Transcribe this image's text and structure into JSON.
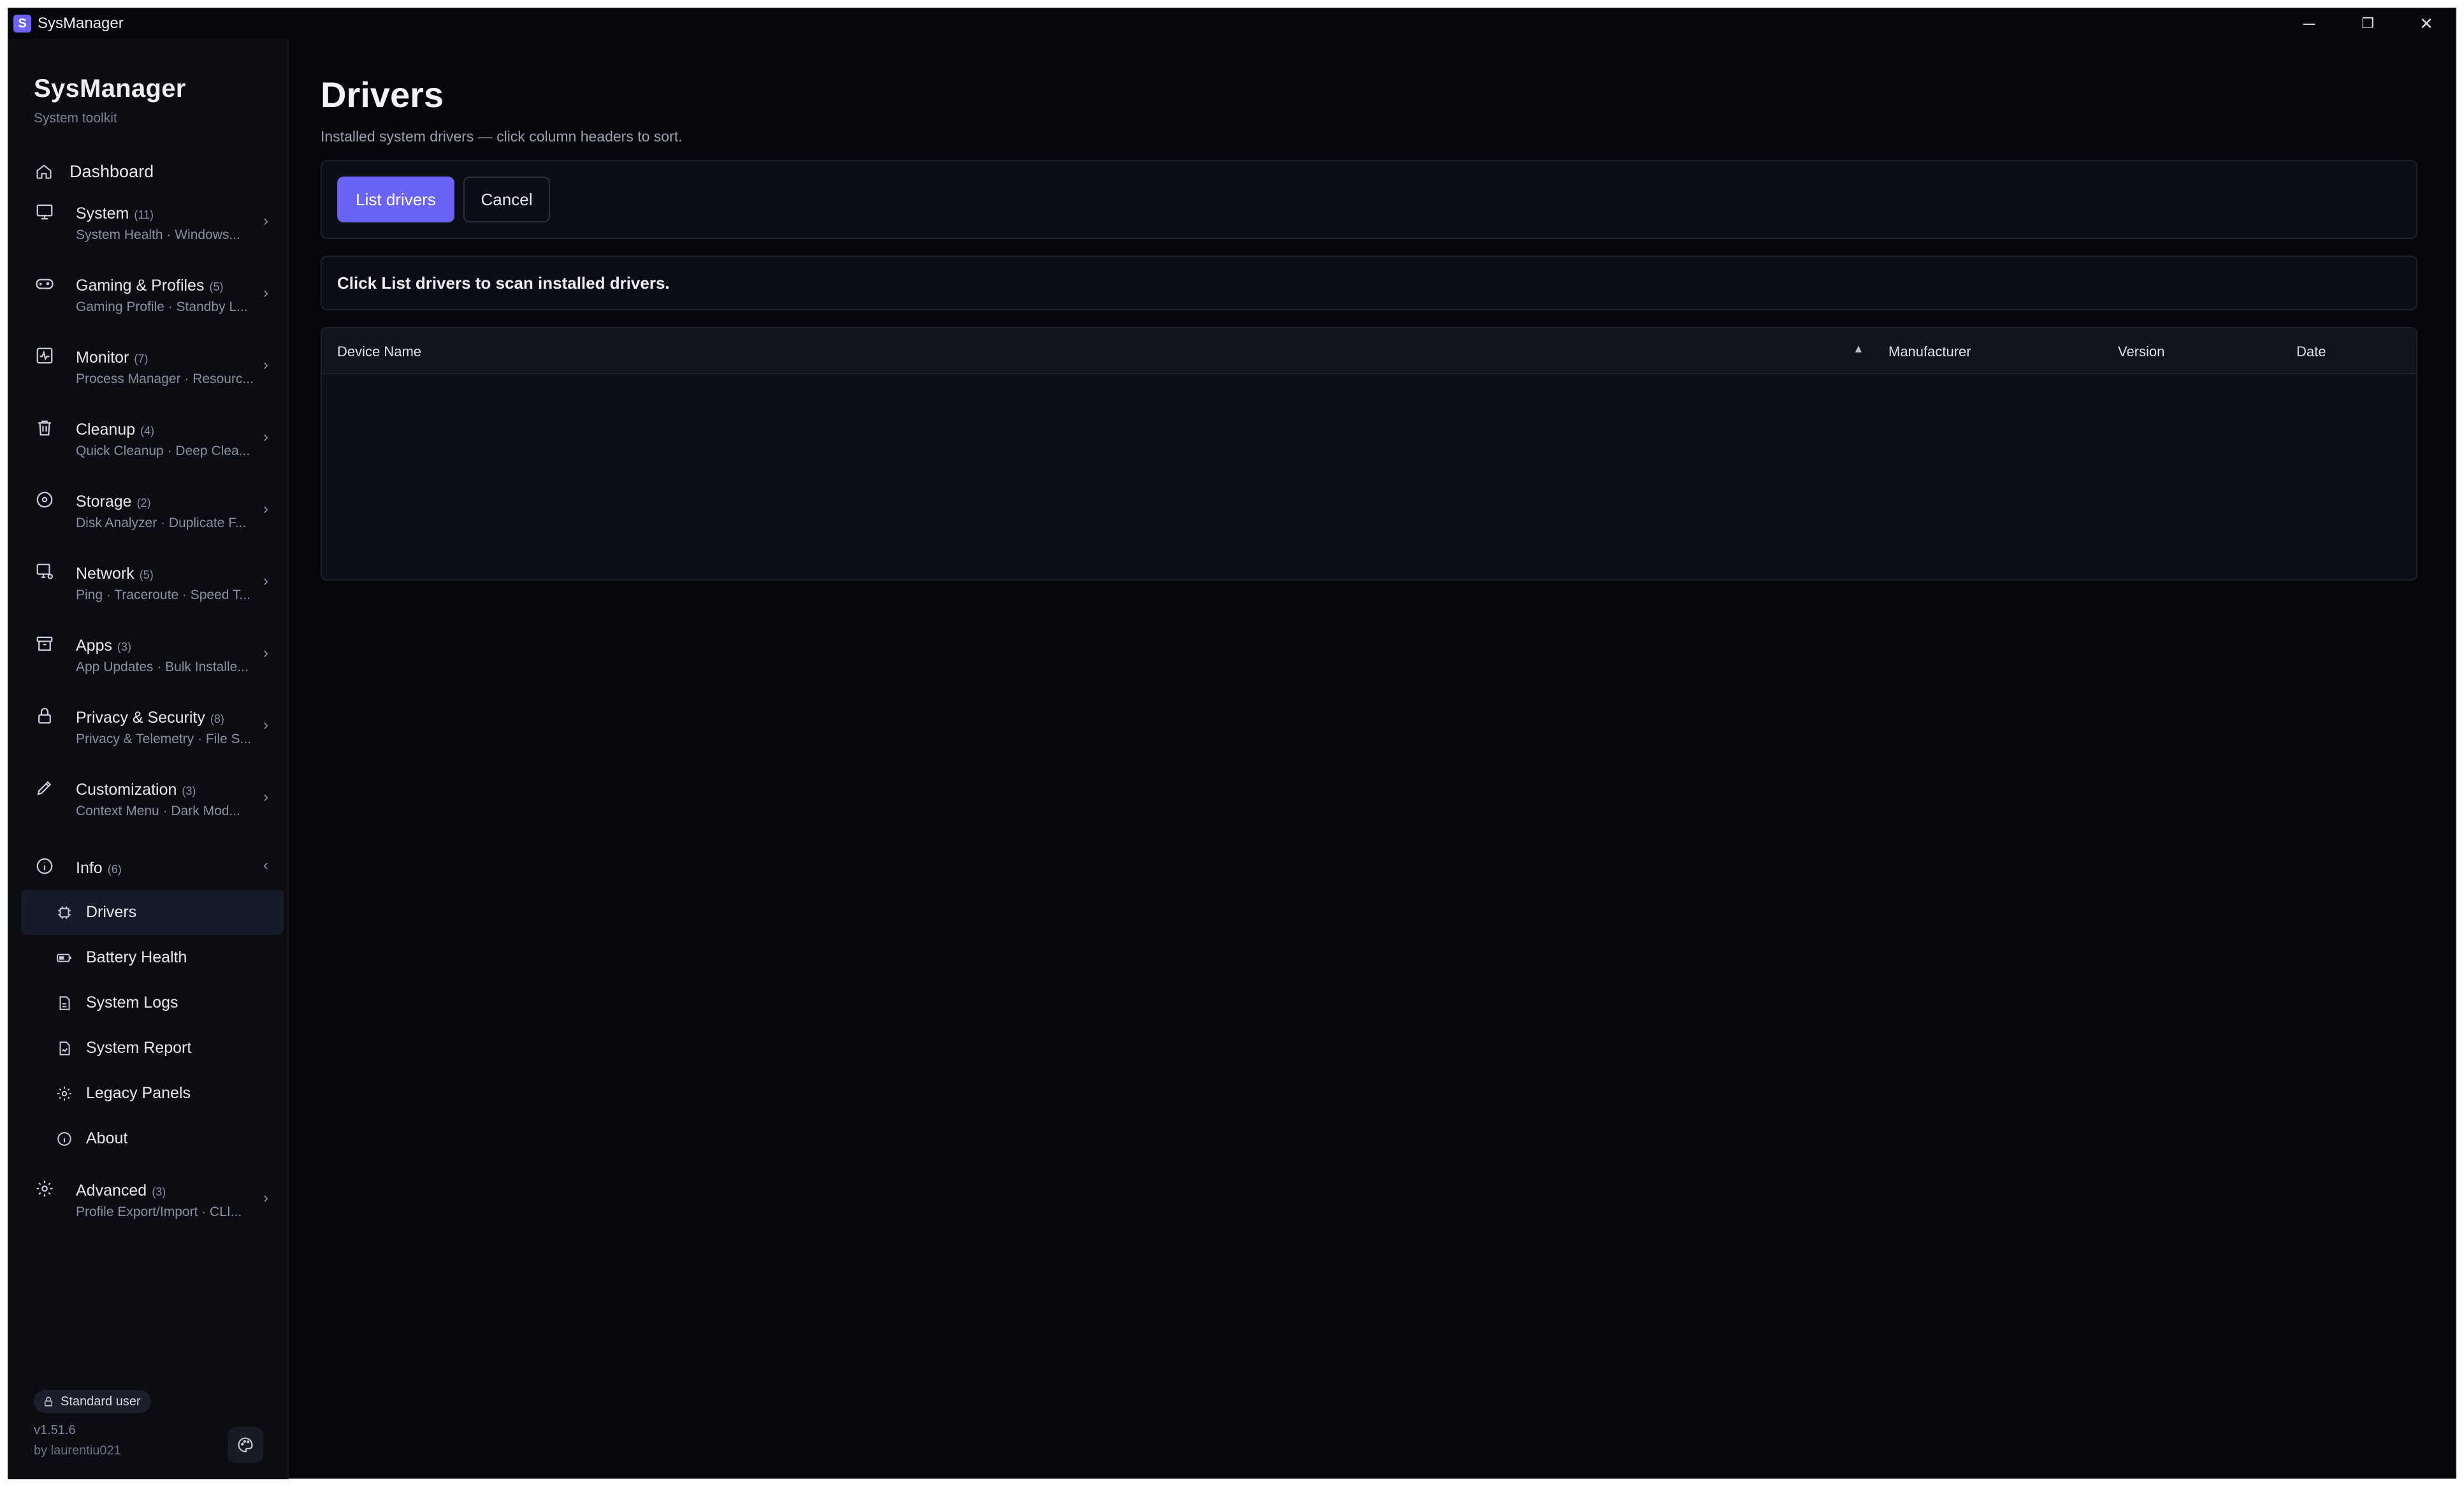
{
  "window": {
    "title": "SysManager",
    "app_icon_letter": "S",
    "controls": {
      "minimize": "─",
      "restore": "❐",
      "close": "✕"
    }
  },
  "brand": {
    "title": "SysManager",
    "subtitle": "System toolkit"
  },
  "sidebar": {
    "dashboard": {
      "label": "Dashboard",
      "icon": "home-icon"
    },
    "groups": [
      {
        "title": "System",
        "count": "(11)",
        "sub": "System Health · Windows...",
        "icon": "computer-icon",
        "chevron": "›"
      },
      {
        "title": "Gaming & Profiles",
        "count": "(5)",
        "sub": "Gaming Profile · Standby L...",
        "icon": "gamepad-icon",
        "chevron": "›"
      },
      {
        "title": "Monitor",
        "count": "(7)",
        "sub": "Process Manager · Resourc...",
        "icon": "activity-icon",
        "chevron": "›"
      },
      {
        "title": "Cleanup",
        "count": "(4)",
        "sub": "Quick Cleanup · Deep Clea...",
        "icon": "trash-icon",
        "chevron": "›"
      },
      {
        "title": "Storage",
        "count": "(2)",
        "sub": "Disk Analyzer · Duplicate F...",
        "icon": "disk-icon",
        "chevron": "›"
      },
      {
        "title": "Network",
        "count": "(5)",
        "sub": "Ping · Traceroute · Speed T...",
        "icon": "network-icon",
        "chevron": "›"
      },
      {
        "title": "Apps",
        "count": "(3)",
        "sub": "App Updates · Bulk Installe...",
        "icon": "archive-icon",
        "chevron": "›"
      },
      {
        "title": "Privacy & Security",
        "count": "(8)",
        "sub": "Privacy & Telemetry · File S...",
        "icon": "lock-icon",
        "chevron": "›"
      },
      {
        "title": "Customization",
        "count": "(3)",
        "sub": "Context Menu · Dark Mod...",
        "icon": "brush-icon",
        "chevron": "›"
      }
    ],
    "info_group": {
      "title": "Info",
      "count": "(6)",
      "icon": "info-icon",
      "chevron": "‹"
    },
    "info_items": [
      {
        "label": "Drivers",
        "icon": "chip-icon",
        "active": true
      },
      {
        "label": "Battery Health",
        "icon": "battery-icon"
      },
      {
        "label": "System Logs",
        "icon": "log-file-icon"
      },
      {
        "label": "System Report",
        "icon": "report-icon"
      },
      {
        "label": "Legacy Panels",
        "icon": "gear-icon"
      },
      {
        "label": "About",
        "icon": "info-icon"
      }
    ],
    "advanced_group": {
      "title": "Advanced",
      "count": "(3)",
      "sub": "Profile Export/Import · CLI...",
      "icon": "gear-icon",
      "chevron": "›"
    },
    "user_badge": "Standard user",
    "version": "v1.51.6",
    "author": "by laurentiu021"
  },
  "main": {
    "title": "Drivers",
    "subtitle": "Installed system drivers — click column headers to sort.",
    "list_button": "List drivers",
    "cancel_button": "Cancel",
    "status": "Click List drivers to scan installed drivers.",
    "columns": [
      "Device Name",
      "Manufacturer",
      "Version",
      "Date"
    ],
    "sort_indicator": "▲"
  },
  "colors": {
    "accent": "#6a63f5",
    "background": "#05070b",
    "sidebar": "#0b0d13",
    "active_item": "#161b29"
  }
}
